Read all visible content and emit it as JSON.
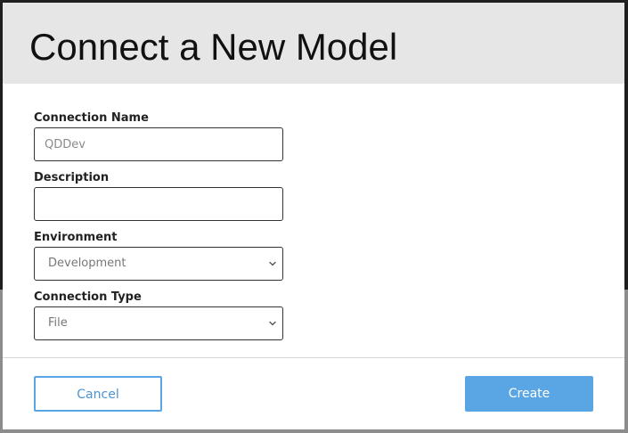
{
  "dialog": {
    "title": "Connect a New Model"
  },
  "form": {
    "connection_name": {
      "label": "Connection Name",
      "placeholder": "QDDev",
      "value": ""
    },
    "description": {
      "label": "Description",
      "placeholder": "",
      "value": ""
    },
    "environment": {
      "label": "Environment",
      "selected": "Development"
    },
    "connection_type": {
      "label": "Connection Type",
      "selected": "File"
    }
  },
  "footer": {
    "cancel_label": "Cancel",
    "create_label": "Create"
  },
  "colors": {
    "accent": "#5aa5e4",
    "header_bg": "#e6e6e6"
  },
  "icons": {
    "select_arrow": "chevron-down-icon"
  }
}
